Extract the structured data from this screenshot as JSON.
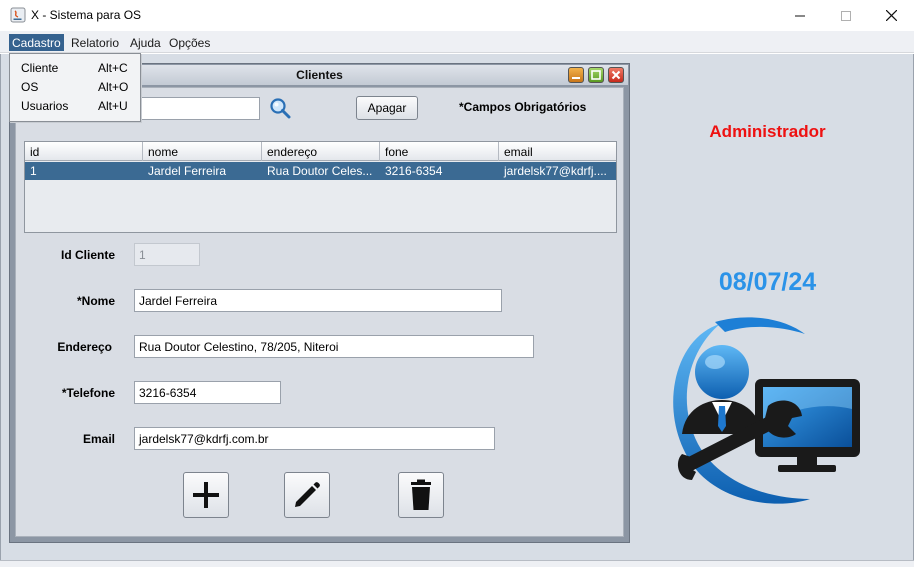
{
  "window": {
    "title": "X - Sistema para OS"
  },
  "menubar": {
    "items": [
      "Cadastro",
      "Relatorio",
      "Ajuda",
      "Opções"
    ]
  },
  "dropdown": {
    "items": [
      {
        "label": "Cliente",
        "accel": "Alt+C"
      },
      {
        "label": "OS",
        "accel": "Alt+O"
      },
      {
        "label": "Usuarios",
        "accel": "Alt+U"
      }
    ]
  },
  "clientes": {
    "title": "Clientes",
    "search": {
      "value": ""
    },
    "apagar_label": "Apagar",
    "required_note": "*Campos Obrigatórios",
    "table": {
      "columns": [
        "id",
        "nome",
        "endereço",
        "fone",
        "email"
      ],
      "rows": [
        [
          "1",
          "Jardel Ferreira",
          "Rua Doutor Celes...",
          "3216-6354",
          "jardelsk77@kdrfj...."
        ]
      ]
    },
    "form": {
      "id_label": "Id Cliente",
      "id_value": "1",
      "nome_label": "*Nome",
      "nome_value": "Jardel Ferreira",
      "endereco_label": "Endereço",
      "endereco_value": "Rua Doutor Celestino, 78/205, Niteroi",
      "telefone_label": "*Telefone",
      "telefone_value": "3216-6354",
      "email_label": "Email",
      "email_value": "jardelsk77@kdrfj.com.br"
    },
    "actions": {
      "add_icon": "plus-icon",
      "edit_icon": "pencil-icon",
      "delete_icon": "trash-icon"
    }
  },
  "side": {
    "user_label": "Administrador",
    "date": "08/07/24",
    "logo_icon": "technician-monitor-wrench-logo"
  },
  "colors": {
    "accent_selection": "#3b6a93",
    "user_label": "#ee1111",
    "date": "#2b93e8"
  }
}
